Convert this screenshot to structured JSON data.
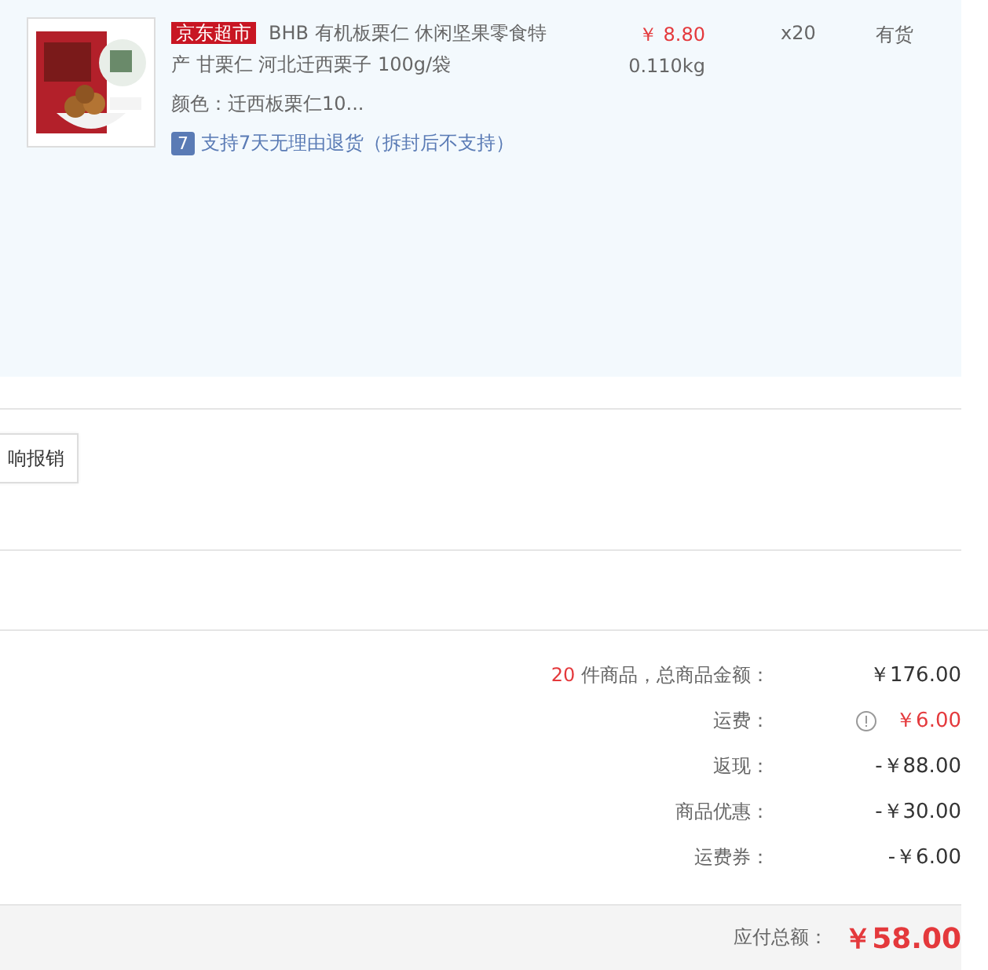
{
  "product": {
    "store_tag": "京东超市",
    "title": "BHB 有机板栗仁 休闲坚果零食特产 甘栗仁 河北迁西栗子 100g/袋",
    "variant": "颜色：迁西板栗仁10...",
    "return_badge": "7",
    "return_policy": "支持7天无理由退货（拆封后不支持）",
    "price": "￥ 8.80",
    "weight": "0.110kg",
    "quantity": "x20",
    "stock": "有货"
  },
  "invoice_button": "响报销",
  "summary": [
    {
      "count": "20",
      "label": " 件商品，总商品金额：",
      "value": "￥176.00",
      "kind": "plain",
      "info": false
    },
    {
      "label": "运费：",
      "value": "￥6.00",
      "kind": "accent",
      "info": true
    },
    {
      "label": "返现：",
      "value": "-￥88.00",
      "kind": "plain",
      "info": false
    },
    {
      "label": "商品优惠：",
      "value": "-￥30.00",
      "kind": "plain",
      "info": false
    },
    {
      "label": "运费券：",
      "value": "-￥6.00",
      "kind": "plain",
      "info": false
    }
  ],
  "total": {
    "label": "应付总额：",
    "value": "￥58.00"
  }
}
